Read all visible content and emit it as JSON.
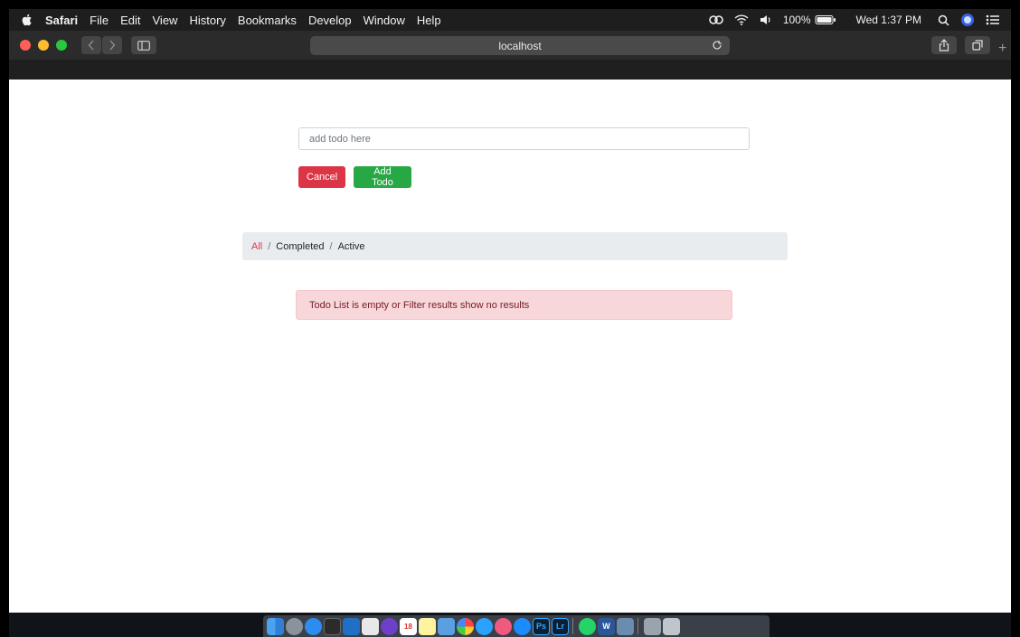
{
  "menubar": {
    "app_name": "Safari",
    "items": [
      "File",
      "Edit",
      "View",
      "History",
      "Bookmarks",
      "Develop",
      "Window",
      "Help"
    ],
    "battery": "100%",
    "clock": "Wed 1:37 PM"
  },
  "browser": {
    "url": "localhost",
    "new_tab_label": "+"
  },
  "todo": {
    "input_placeholder": "add todo here",
    "cancel_label": "Cancel",
    "add_label": "Add Todo"
  },
  "filters": {
    "separator": "/",
    "items": [
      {
        "label": "All",
        "active": true
      },
      {
        "label": "Completed",
        "active": false
      },
      {
        "label": "Active",
        "active": false
      }
    ]
  },
  "alert": {
    "message": "Todo List is empty or Filter results show no results"
  },
  "dock": {
    "photoshop_label": "Ps",
    "lightroom_label": "Lr",
    "word_label": "W",
    "calendar_day": "18"
  },
  "colors": {
    "danger": "#dc3545",
    "success": "#28a745",
    "alert_bg": "#f8d7da",
    "alert_text": "#721c24",
    "breadcrumb_bg": "#e9ecef"
  }
}
